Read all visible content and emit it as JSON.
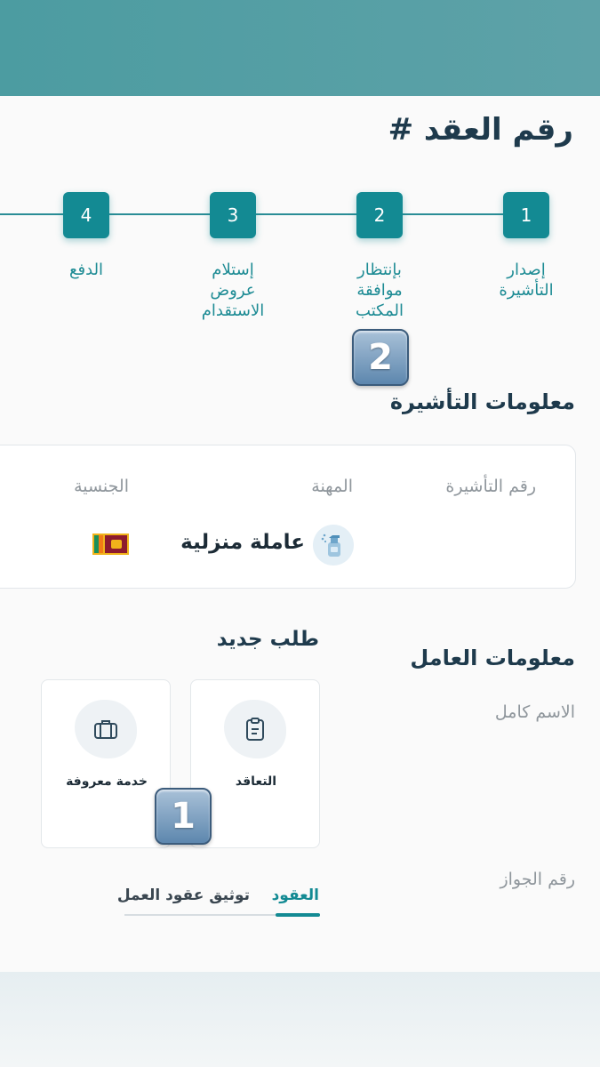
{
  "page_title": "رقم العقد #",
  "steps": [
    {
      "number": "1",
      "label": "إصدار التأشيرة"
    },
    {
      "number": "2",
      "label": "بإنتظار موافقة المكتب"
    },
    {
      "number": "3",
      "label": "إستلام عروض الاستقدام"
    },
    {
      "number": "4",
      "label": "الدفع"
    }
  ],
  "badges": {
    "step_marker": "2",
    "tile_marker": "1"
  },
  "visa_info": {
    "title": "معلومات التأشيرة",
    "visa_number_label": "رقم التأشيرة",
    "occupation_label": "المهنة",
    "nationality_label": "الجنسية",
    "occupation_value": "عاملة منزلية",
    "occupation_icon": "spray-bottle-icon",
    "nationality_flag": "sri-lanka-flag"
  },
  "worker_info": {
    "title": "معلومات العامل",
    "full_name_label": "الاسم كامل",
    "passport_label": "رقم الجواز"
  },
  "new_request": {
    "title": "طلب جديد",
    "tiles": [
      {
        "label": "التعاقد",
        "icon": "clipboard-icon"
      },
      {
        "label": "خدمة معروفة",
        "icon": "briefcase-icon"
      }
    ]
  },
  "tabs": [
    {
      "label": "العقود",
      "active": true
    },
    {
      "label": "توثيق عقود العمل",
      "active": false
    }
  ],
  "colors": {
    "brand": "#138a93",
    "header": "#4f9da2",
    "heading_text": "#1e3a4c",
    "muted_text": "#8f969c"
  }
}
